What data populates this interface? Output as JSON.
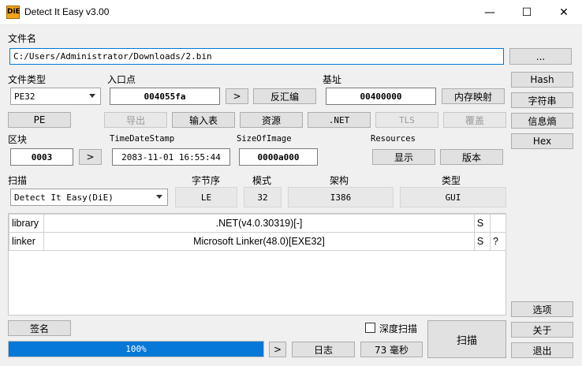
{
  "window": {
    "title": "Detect It Easy v3.00",
    "logo_text": "DiE",
    "minimize": "—",
    "maximize": "☐",
    "close": "✕"
  },
  "file": {
    "label": "文件名",
    "path": "C:/Users/Administrator/Downloads/2.bin",
    "browse": "..."
  },
  "filetype": {
    "label": "文件类型",
    "value": "PE32"
  },
  "entry": {
    "label": "入口点",
    "value": "004055fa",
    "go": ">",
    "disasm": "反汇编"
  },
  "base": {
    "label": "基址",
    "value": "00400000",
    "memmap": "内存映射"
  },
  "right_buttons": {
    "hash": "Hash",
    "strings": "字符串",
    "entropy": "信息熵",
    "hex": "Hex",
    "options": "选项",
    "about": "关于",
    "exit": "退出"
  },
  "pe_row": {
    "pe": "PE",
    "export": "导出",
    "import": "输入表",
    "resources": "资源",
    "net": ".NET",
    "tls": "TLS",
    "overlay": "覆盖"
  },
  "section": {
    "label": "区块",
    "value": "0003",
    "go": ">",
    "timestamp_label": "TimeDateStamp",
    "timestamp": "2083-11-01 16:55:44",
    "sizeofimage_label": "SizeOfImage",
    "sizeofimage": "0000a000",
    "resources_label": "Resources",
    "show": "显示",
    "version": "版本"
  },
  "scan": {
    "label": "扫描",
    "engine": "Detect It Easy(DiE)",
    "endian_label": "字节序",
    "endian": "LE",
    "mode_label": "模式",
    "mode": "32",
    "arch_label": "架构",
    "arch": "I386",
    "type_label": "类型",
    "type": "GUI"
  },
  "results": [
    {
      "kind": "library",
      "name": ".NET(v4.0.30319)[-]",
      "flag": "S",
      "extra": ""
    },
    {
      "kind": "linker",
      "name": "Microsoft Linker(48.0)[EXE32]",
      "flag": "S",
      "extra": "?"
    }
  ],
  "bottom": {
    "signature": "签名",
    "deep_scan": "深度扫描",
    "scan_button": "扫描",
    "progress_text": "100%",
    "progress_value": 1.0,
    "log_go": ">",
    "log": "日志",
    "time": "73 毫秒"
  },
  "colors": {
    "accent": "#0678d7",
    "background": "#f0f0f0"
  }
}
